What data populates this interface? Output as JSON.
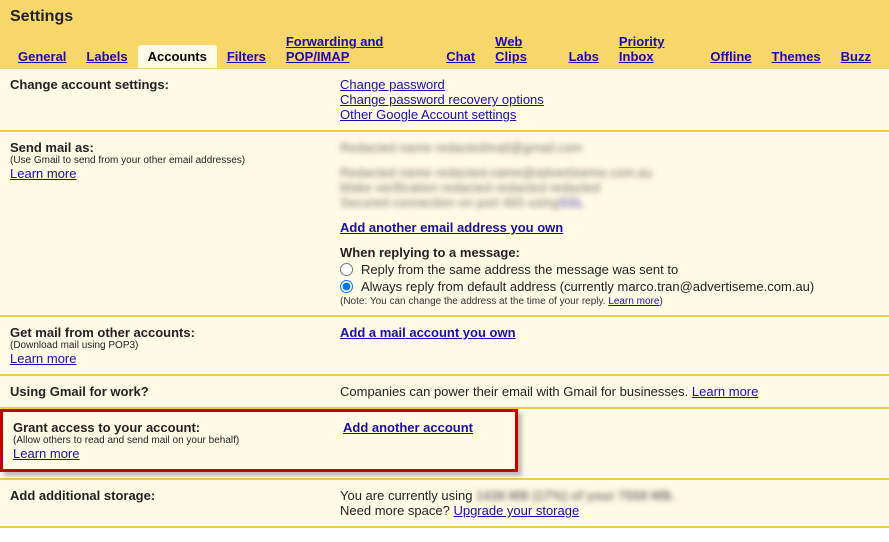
{
  "page_title": "Settings",
  "tabs": [
    "General",
    "Labels",
    "Accounts",
    "Filters",
    "Forwarding and POP/IMAP",
    "Chat",
    "Web Clips",
    "Labs",
    "Priority Inbox",
    "Offline",
    "Themes",
    "Buzz"
  ],
  "active_tab_index": 2,
  "sections": {
    "change_account": {
      "label": "Change account settings:",
      "links": [
        "Change password",
        "Change password recovery options",
        "Other Google Account settings"
      ]
    },
    "send_mail_as": {
      "label": "Send mail as:",
      "sub": "(Use Gmail to send from your other email addresses)",
      "learn": "Learn more",
      "add_link": "Add another email address you own",
      "reply_header": "When replying to a message:",
      "reply_opt1": "Reply from the same address the message was sent to",
      "reply_opt2_prefix": "Always reply from default address (currently ",
      "reply_opt2_email": "marco.tran@advertiseme.com.au",
      "reply_opt2_suffix": ")",
      "note_prefix": "(Note: You can change the address at the time of your reply. ",
      "note_link": "Learn more",
      "note_suffix": ")"
    },
    "get_mail": {
      "label": "Get mail from other accounts:",
      "sub": "(Download mail using POP3)",
      "learn": "Learn more",
      "add_link": "Add a mail account you own"
    },
    "using_for_work": {
      "label": "Using Gmail for work?",
      "text": "Companies can power their email with Gmail for businesses. ",
      "link": "Learn more"
    },
    "grant_access": {
      "label": "Grant access to your account:",
      "sub": "(Allow others to read and send mail on your behalf)",
      "learn": "Learn more",
      "add_link": "Add another account"
    },
    "storage": {
      "label": "Add additional storage:",
      "line1_prefix": "You are currently using ",
      "line2_prefix": "Need more space? ",
      "line2_link": "Upgrade your storage"
    }
  }
}
